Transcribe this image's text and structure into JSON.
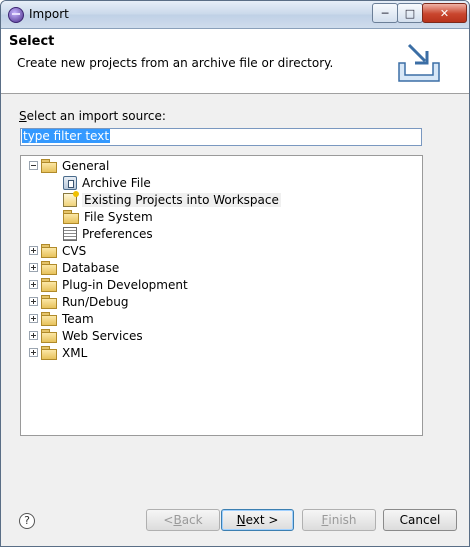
{
  "window": {
    "title": "Import"
  },
  "header": {
    "title": "Select",
    "description": "Create new projects from an archive file or directory."
  },
  "source": {
    "label_prefix": "",
    "label_mnemonic": "S",
    "label_rest": "elect an import source:",
    "filter_value": "type filter text"
  },
  "tree": {
    "general": {
      "label": "General",
      "children": [
        "Archive File",
        "Existing Projects into Workspace",
        "File System",
        "Preferences"
      ]
    },
    "categories": [
      "CVS",
      "Database",
      "Plug-in Development",
      "Run/Debug",
      "Team",
      "Web Services",
      "XML"
    ]
  },
  "buttons": {
    "back_pre": "< ",
    "back_mn": "B",
    "back_post": "ack",
    "next_mn": "N",
    "next_post": "ext >",
    "finish_mn": "F",
    "finish_post": "inish",
    "cancel": "Cancel"
  }
}
